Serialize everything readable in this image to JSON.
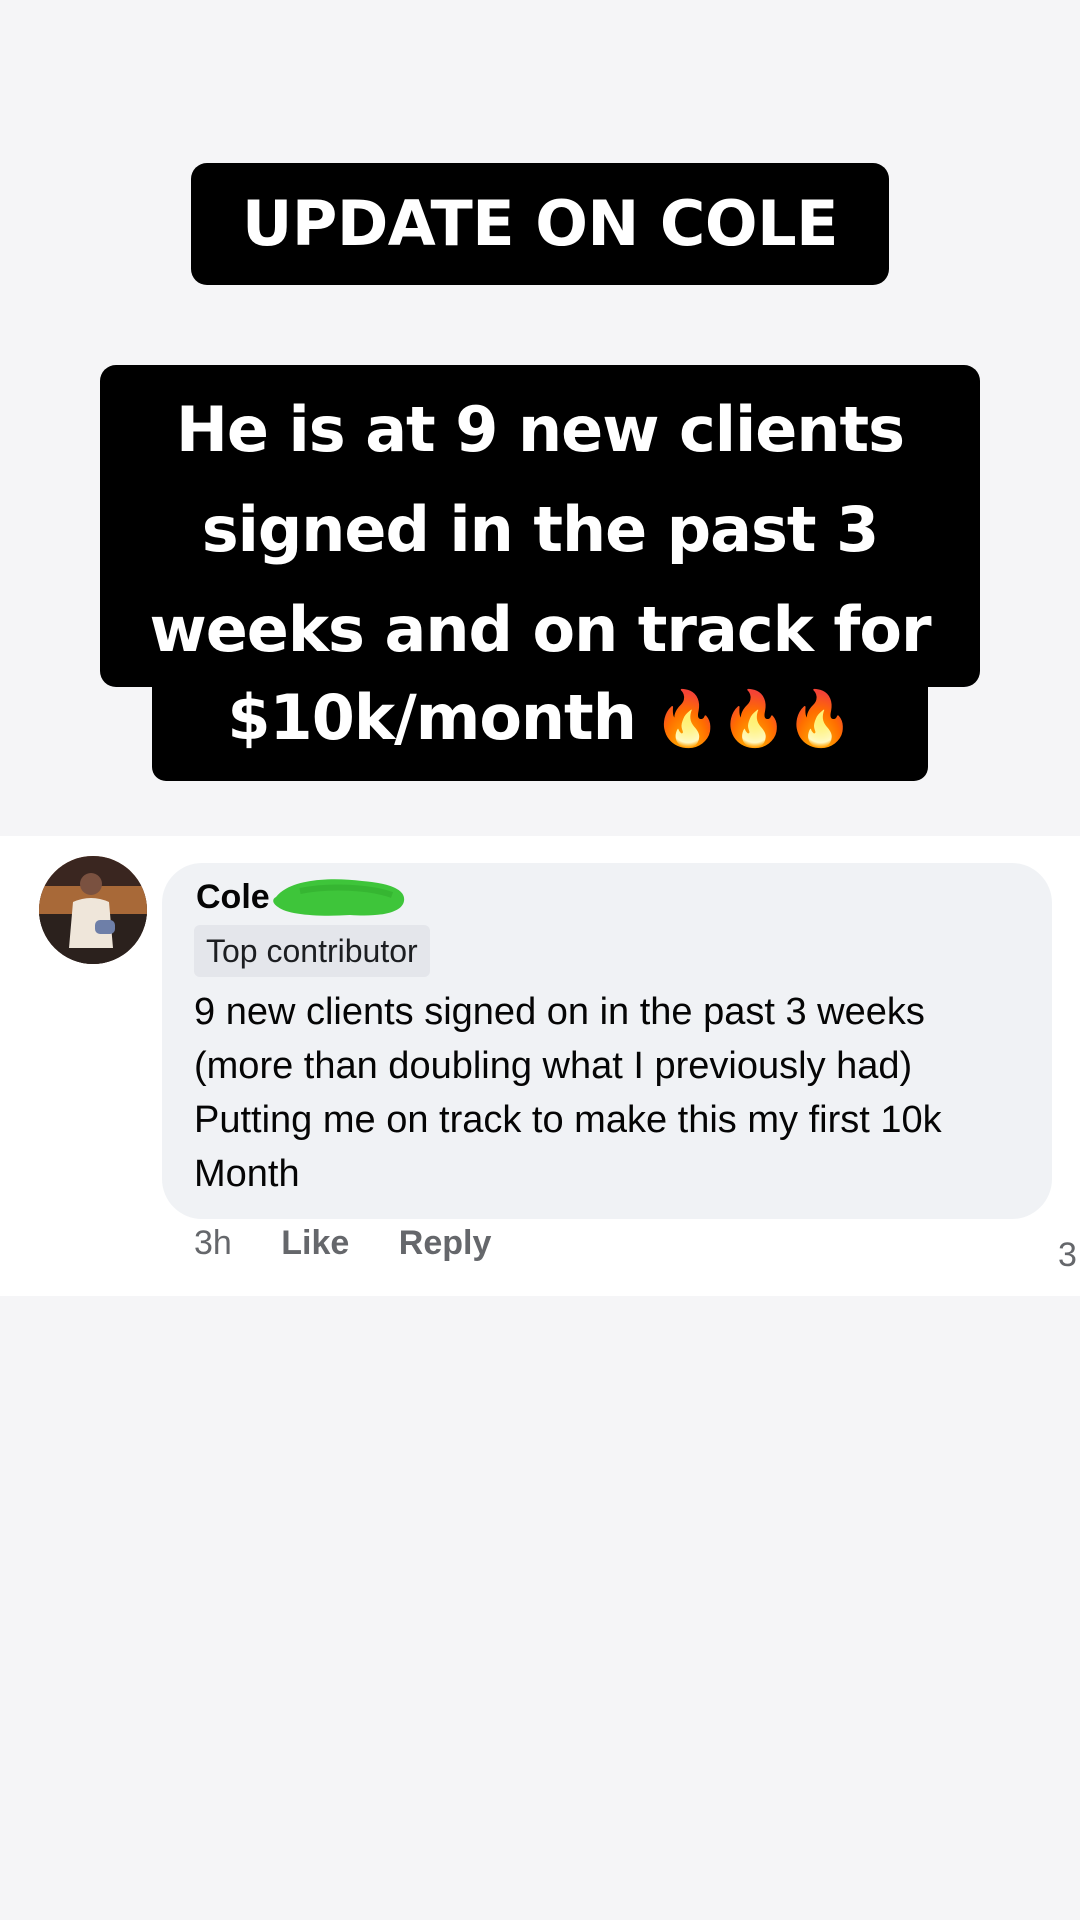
{
  "story": {
    "headline": "UPDATE ON COLE",
    "caption_lines": [
      "He is at 9 new clients",
      "signed in the past 3",
      "weeks and on track for",
      "$10k/month"
    ],
    "caption_emoji": "🔥🔥🔥",
    "caption_emoji_name": "fire-emoji"
  },
  "comment": {
    "author_name": "Cole",
    "author_name_redacted": true,
    "redaction_color": "#3ec53a",
    "badge": "Top contributor",
    "body_lines": [
      "9 new clients signed on in the past 3 weeks",
      "(more than doubling what I previously had)",
      "Putting me on track to make this my first 10k",
      "Month"
    ],
    "time": "3h",
    "like_label": "Like",
    "reply_label": "Reply",
    "reaction_count": "3"
  }
}
